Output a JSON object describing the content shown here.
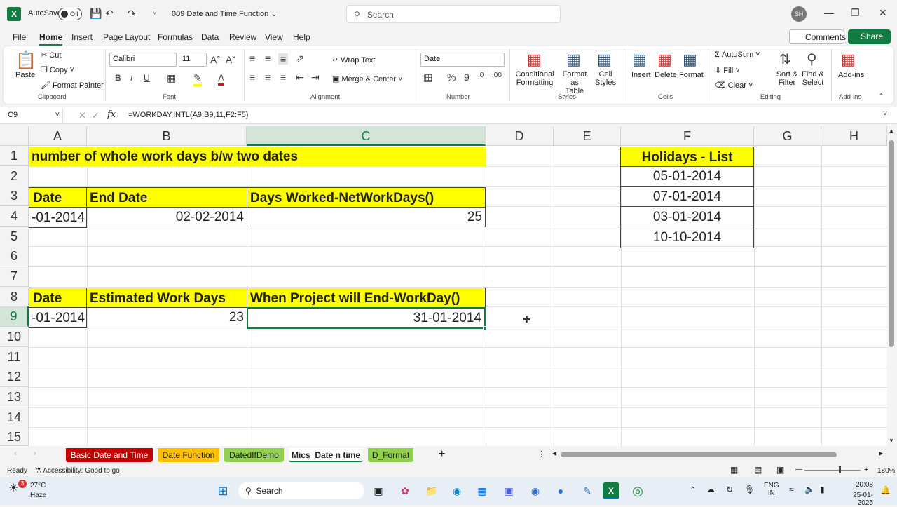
{
  "titlebar": {
    "autosave": "AutoSave",
    "toggle": "Off",
    "doc_title": "009 Date and Time Function",
    "search": "Search",
    "avatar": "SH"
  },
  "menu": [
    "File",
    "Home",
    "Insert",
    "Page Layout",
    "Formulas",
    "Data",
    "Review",
    "View",
    "Help"
  ],
  "buttons": {
    "comments": "Comments",
    "share": "Share"
  },
  "ribbon": {
    "clipboard": {
      "paste": "Paste",
      "cut": "Cut",
      "copy": "Copy",
      "format_painter": "Format Painter",
      "label": "Clipboard"
    },
    "font": {
      "name": "Calibri",
      "size": "11",
      "label": "Font"
    },
    "alignment": {
      "wrap": "Wrap Text",
      "merge": "Merge & Center",
      "label": "Alignment"
    },
    "number": {
      "format": "Date",
      "label": "Number"
    },
    "styles": {
      "cond1": "Conditional",
      "cond2": "Formatting",
      "fmt1": "Format as",
      "fmt2": "Table",
      "cell1": "Cell",
      "cell2": "Styles",
      "label": "Styles"
    },
    "cells": {
      "insert": "Insert",
      "delete": "Delete",
      "format": "Format",
      "label": "Cells"
    },
    "editing": {
      "autosum": "AutoSum",
      "fill": "Fill",
      "clear": "Clear",
      "sort1": "Sort &",
      "sort2": "Filter",
      "find1": "Find &",
      "find2": "Select",
      "label": "Editing"
    },
    "addins": {
      "btn": "Add-ins",
      "label": "Add-ins"
    }
  },
  "formula_bar": {
    "namebox": "C9",
    "fx": "fx",
    "formula": "=WORKDAY.INTL(A9,B9,11,F2:F5)"
  },
  "columns": [
    "A",
    "B",
    "C",
    "D",
    "E",
    "F",
    "G",
    "H"
  ],
  "rows": [
    "1",
    "2",
    "3",
    "4",
    "5",
    "6",
    "7",
    "8",
    "9",
    "10",
    "11",
    "12",
    "13",
    "14",
    "15"
  ],
  "cells": {
    "a1": "number of whole work days b/w two dates",
    "a3": "Date",
    "b3": "End Date",
    "c3": "Days Worked-NetWorkDays()",
    "a4": "-01-2014",
    "b4": "02-02-2014",
    "c4": "25",
    "a8": "Date",
    "b8": "Estimated Work Days",
    "c8": "When Project will End-WorkDay()",
    "a9": "-01-2014",
    "b9": "23",
    "c9": "31-01-2014",
    "f1": "Holidays - List",
    "f2": "05-01-2014",
    "f3": "07-01-2014",
    "f4": "03-01-2014",
    "f5": "10-10-2014"
  },
  "tabs": [
    {
      "label": "Basic Date and Time",
      "color": "#c00000"
    },
    {
      "label": "Date Function",
      "color": "#ffc000"
    },
    {
      "label": "DatedIfDemo",
      "color": "#92d050"
    },
    {
      "label": "Mics  Date n time",
      "color": "#ffffff"
    },
    {
      "label": "D_Format",
      "color": "#92d050"
    }
  ],
  "status": {
    "ready": "Ready",
    "accessibility": "Accessibility: Good to go",
    "zoom": "180%"
  },
  "taskbar": {
    "temp": "27°C",
    "weather": "Haze",
    "search": "Search",
    "lang1": "ENG",
    "lang2": "IN",
    "time": "20:08",
    "date": "25-01-2025",
    "badge": "3"
  }
}
